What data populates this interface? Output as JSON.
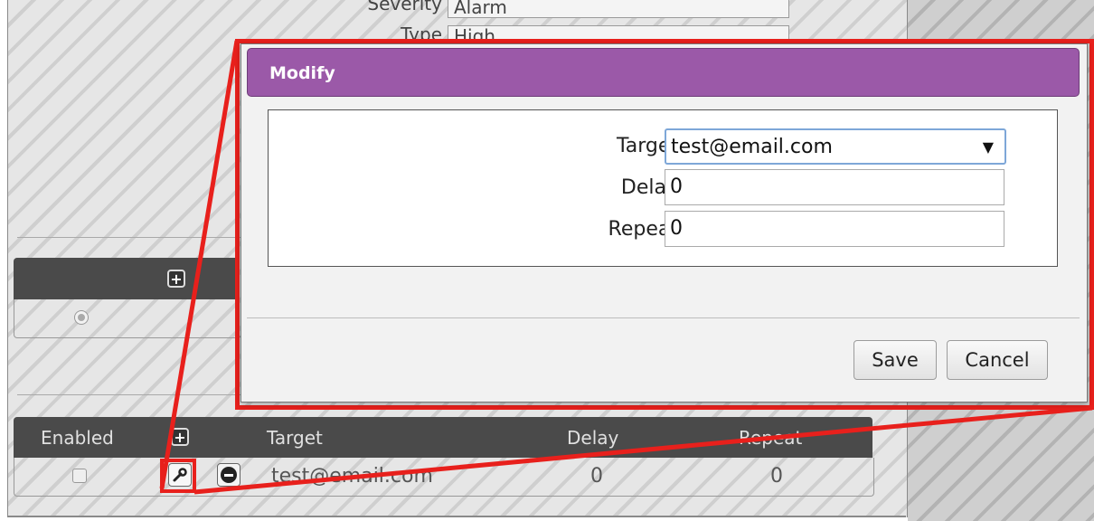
{
  "background": {
    "top_form": {
      "severity_label": "Severity",
      "severity_value": "Alarm",
      "type_label": "Type",
      "type_value": "High"
    },
    "actions_table": {
      "radio_selected": true
    },
    "targets_table": {
      "columns": [
        "Enabled",
        "Target",
        "Delay",
        "Repeat"
      ],
      "rows": [
        {
          "enabled": false,
          "target": "test@email.com",
          "delay": "0",
          "repeat": "0"
        }
      ]
    }
  },
  "modal": {
    "title": "Modify",
    "fields": {
      "target_label": "Target",
      "target_value": "test@email.com",
      "delay_label": "Delay",
      "delay_value": "0",
      "repeat_label": "Repeat",
      "repeat_value": "0"
    },
    "buttons": {
      "save": "Save",
      "cancel": "Cancel"
    }
  },
  "colors": {
    "title_bar": "#9b59a8",
    "highlight": "#e8201c"
  },
  "icons": [
    "plus-icon",
    "wrench-icon",
    "minus-icon",
    "dropdown-arrow-icon",
    "radio-icon",
    "checkbox-icon"
  ]
}
